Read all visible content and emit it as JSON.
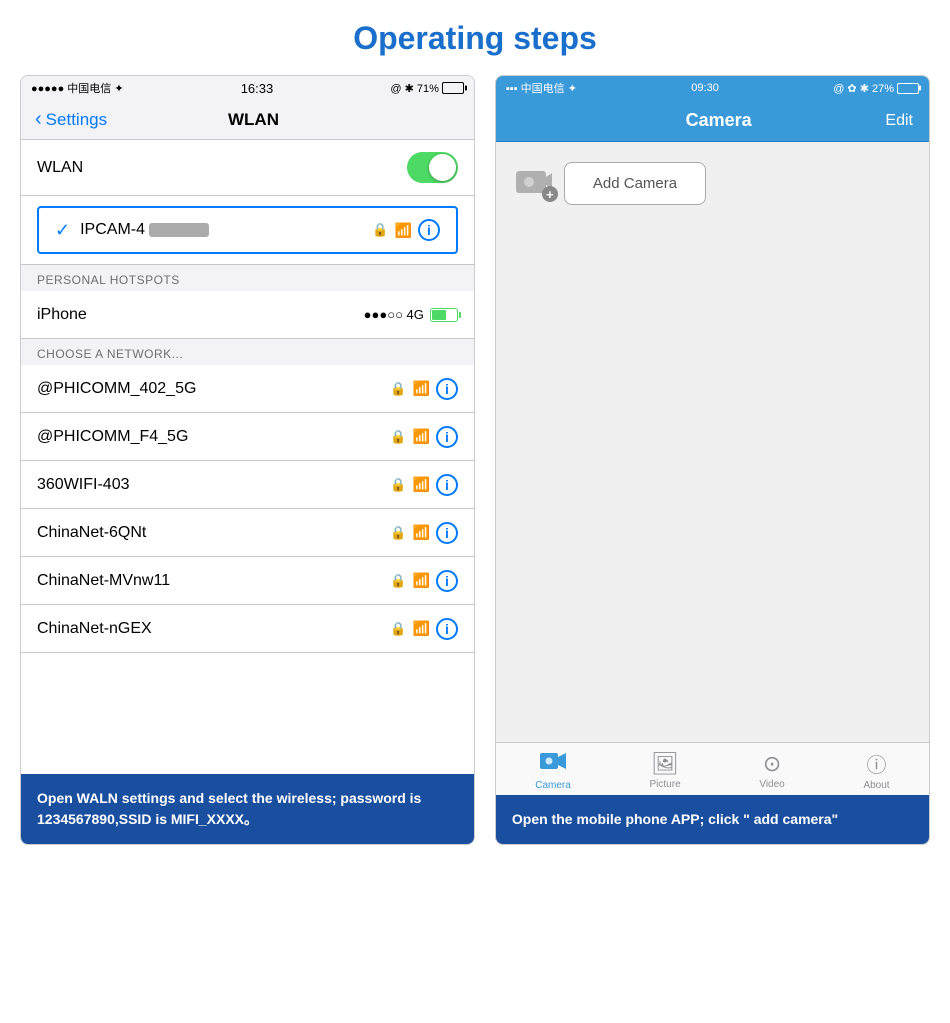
{
  "page": {
    "title": "Operating steps"
  },
  "left_phone": {
    "status_bar": {
      "left": "●●●●● 中国电信 ✦",
      "center": "16:33",
      "right": "@ ✱ 71%"
    },
    "nav": {
      "back_label": "Settings",
      "title": "WLAN"
    },
    "wlan_row": {
      "label": "WLAN"
    },
    "selected_network": {
      "name": "IPCAM-4"
    },
    "section_hotspot": {
      "header": "PERSONAL HOTSPOTS",
      "iphone_label": "iPhone",
      "signal": "●●●○○ 4G"
    },
    "section_choose": {
      "header": "CHOOSE A NETWORK..."
    },
    "networks": [
      {
        "name": "@PHICOMM_402_5G"
      },
      {
        "name": "@PHICOMM_F4_5G"
      },
      {
        "name": "360WIFI-403"
      },
      {
        "name": "ChinaNet-6QNt"
      },
      {
        "name": "ChinaNet-MVnw11"
      },
      {
        "name": "ChinaNet-nGEX"
      }
    ],
    "caption": "Open WALN settings and select the wireless; password is 1234567890,SSID is MIFI_XXXX。"
  },
  "right_phone": {
    "status_bar": {
      "left": "▪▪▪ 中国电信 ✦",
      "center": "09:30",
      "right": "@ ✿ ✱ 27%"
    },
    "nav": {
      "title": "Camera",
      "edit_label": "Edit"
    },
    "add_camera_btn": "Add Camera",
    "tabs": [
      {
        "label": "Camera",
        "active": true
      },
      {
        "label": "Picture",
        "active": false
      },
      {
        "label": "Video",
        "active": false
      },
      {
        "label": "About",
        "active": false
      }
    ],
    "caption": "Open the mobile phone APP; click \" add camera\""
  }
}
